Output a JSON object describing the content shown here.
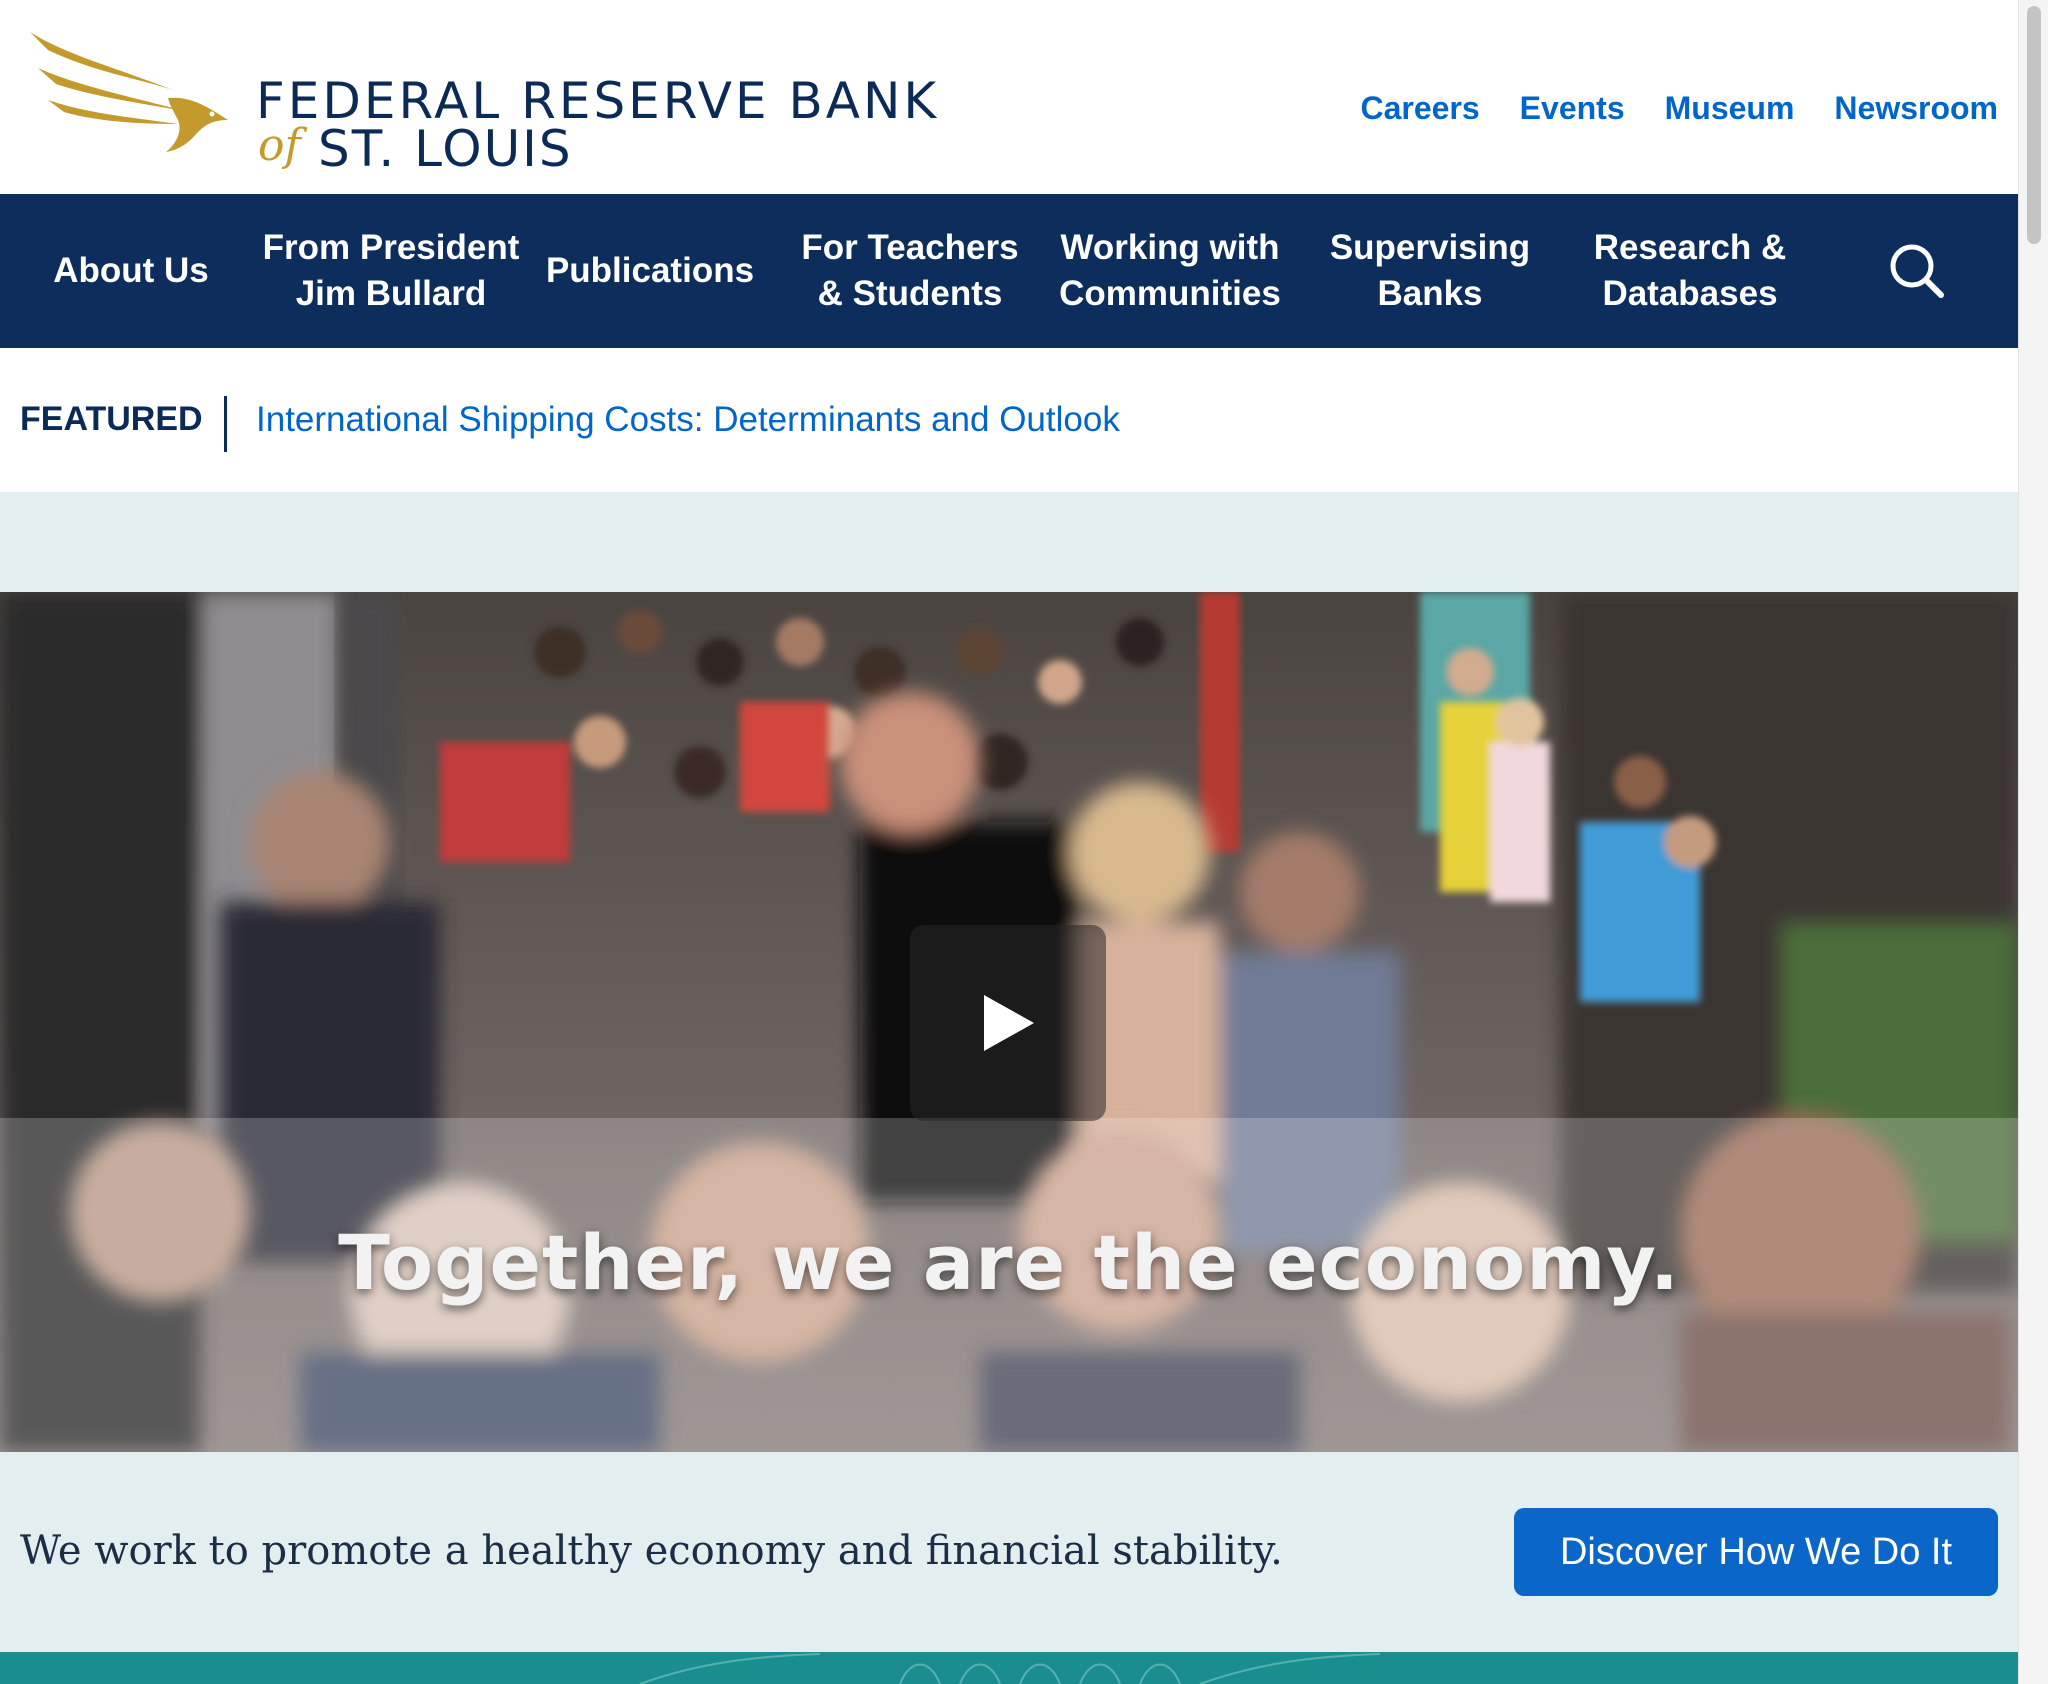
{
  "brand": {
    "line1": "FEDERAL RESERVE BANK",
    "of": "of",
    "line2": "ST. LOUIS",
    "gold": "#c59a2c",
    "navy": "#0b2a55"
  },
  "utility_nav": [
    "Careers",
    "Events",
    "Museum",
    "Newsroom"
  ],
  "main_nav": [
    "About Us",
    "From President\nJim Bullard",
    "Publications",
    "For Teachers\n& Students",
    "Working with\nCommunities",
    "Supervising\nBanks",
    "Research &\nDatabases"
  ],
  "search_icon": "search-icon",
  "featured": {
    "label": "FEATURED",
    "link_text": "International Shipping Costs: Determinants and Outlook"
  },
  "hero": {
    "video_caption": "Together, we are the economy.",
    "play_icon": "play-icon",
    "tagline": "We work to promote a healthy economy and financial stability.",
    "cta_label": "Discover How We Do It"
  },
  "colors": {
    "nav_background": "#0d2e5c",
    "link_blue": "#0066cc",
    "cta_blue": "#0a66c8",
    "hero_band": "#e3eef1",
    "teal": "#1a8d8e"
  }
}
